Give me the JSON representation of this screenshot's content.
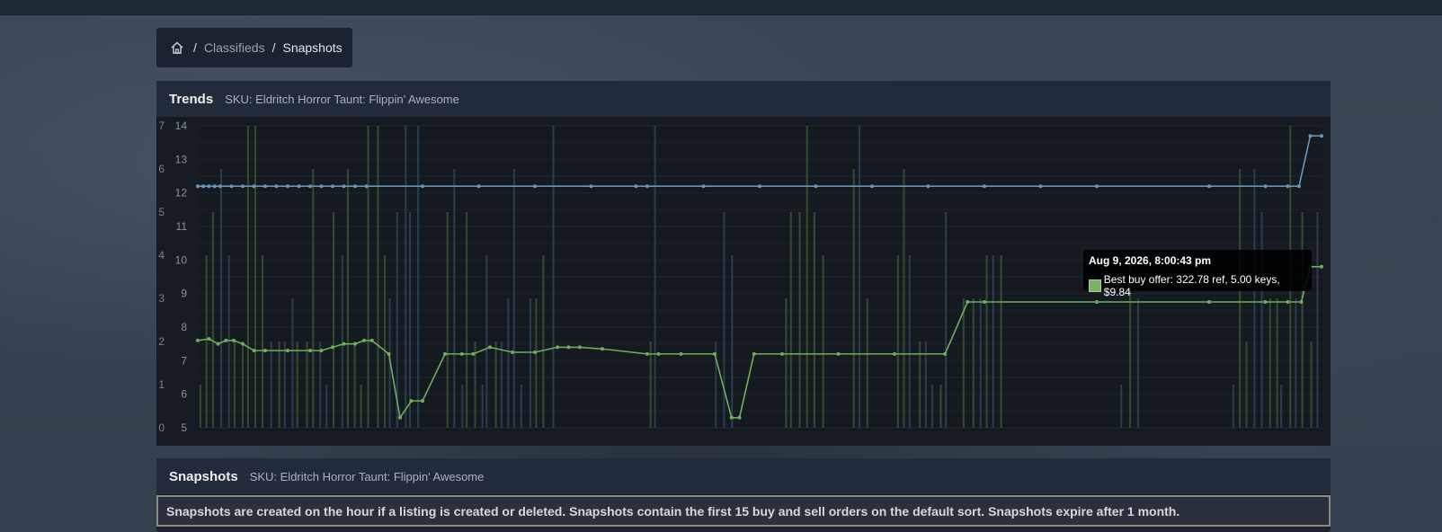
{
  "breadcrumb": {
    "home_icon": "home-icon",
    "items": [
      "Classifieds",
      "Snapshots"
    ]
  },
  "trends": {
    "title": "Trends",
    "sku": "SKU: Eldritch Horror Taunt: Flippin' Awesome"
  },
  "snapshots": {
    "title": "Snapshots",
    "sku": "SKU: Eldritch Horror Taunt: Flippin' Awesome",
    "notice": "Snapshots are created on the hour if a listing is created or deleted. Snapshots contain the first 15 buy and sell orders on the default sort. Snapshots expire after 1 month."
  },
  "tooltip": {
    "title": "Aug 9, 2026, 8:00:43 pm",
    "label": "Best buy offer: 322.78 ref, 5.00 keys, $9.84"
  },
  "colors": {
    "buy": "#6fae5a",
    "sell": "#6a94b8",
    "buy_bar": "#3d5e35",
    "sell_bar": "#33495e"
  },
  "chart_data": {
    "type": "line",
    "y_left_ticks": [
      "0",
      "1",
      "2",
      "3",
      "4",
      "5",
      "6",
      "7"
    ],
    "y_right_ticks": [
      "5",
      "6",
      "7",
      "8",
      "9",
      "10",
      "11",
      "12",
      "13",
      "14"
    ],
    "ylim_left": [
      0,
      7
    ],
    "ylim_right": [
      5,
      14
    ],
    "series": [
      {
        "role": "sell",
        "x": [
          0,
          0.5,
          1,
          1.5,
          2,
          3,
          4,
          5,
          6,
          7,
          8,
          9,
          10,
          11,
          12,
          13,
          14,
          15,
          20,
          25,
          30,
          35,
          39,
          40,
          45,
          50,
          55,
          60,
          65,
          70,
          75,
          80,
          90,
          95,
          97,
          98,
          99,
          100
        ],
        "y": [
          12.2,
          12.2,
          12.2,
          12.2,
          12.2,
          12.2,
          12.2,
          12.2,
          12.2,
          12.2,
          12.2,
          12.2,
          12.2,
          12.2,
          12.2,
          12.2,
          12.2,
          12.2,
          12.2,
          12.2,
          12.2,
          12.2,
          12.2,
          12.2,
          12.2,
          12.2,
          12.2,
          12.2,
          12.2,
          12.2,
          12.2,
          12.2,
          12.2,
          12.2,
          12.2,
          12.2,
          13.7,
          13.7
        ]
      },
      {
        "role": "buy",
        "x": [
          0,
          1,
          1.8,
          2.5,
          3.2,
          4,
          5,
          6,
          8,
          10,
          11,
          12,
          13,
          14,
          14.8,
          15.5,
          17,
          18,
          19,
          20,
          22,
          23.5,
          24.5,
          26,
          28,
          30,
          32,
          33,
          34,
          36,
          40,
          41,
          43,
          46,
          47.5,
          48.2,
          49.5,
          52,
          57,
          62,
          66.5,
          68.5,
          70,
          80,
          90,
          95,
          97,
          98.2,
          99,
          100
        ],
        "y": [
          7.6,
          7.65,
          7.5,
          7.6,
          7.6,
          7.5,
          7.3,
          7.3,
          7.3,
          7.3,
          7.3,
          7.4,
          7.5,
          7.5,
          7.6,
          7.6,
          7.2,
          5.3,
          5.8,
          5.8,
          7.2,
          7.2,
          7.2,
          7.4,
          7.25,
          7.25,
          7.4,
          7.4,
          7.4,
          7.35,
          7.2,
          7.2,
          7.2,
          7.2,
          5.3,
          5.3,
          7.2,
          7.2,
          7.2,
          7.2,
          7.2,
          8.75,
          8.75,
          8.75,
          8.75,
          8.75,
          8.75,
          8.75,
          9.8,
          9.8
        ]
      }
    ]
  }
}
